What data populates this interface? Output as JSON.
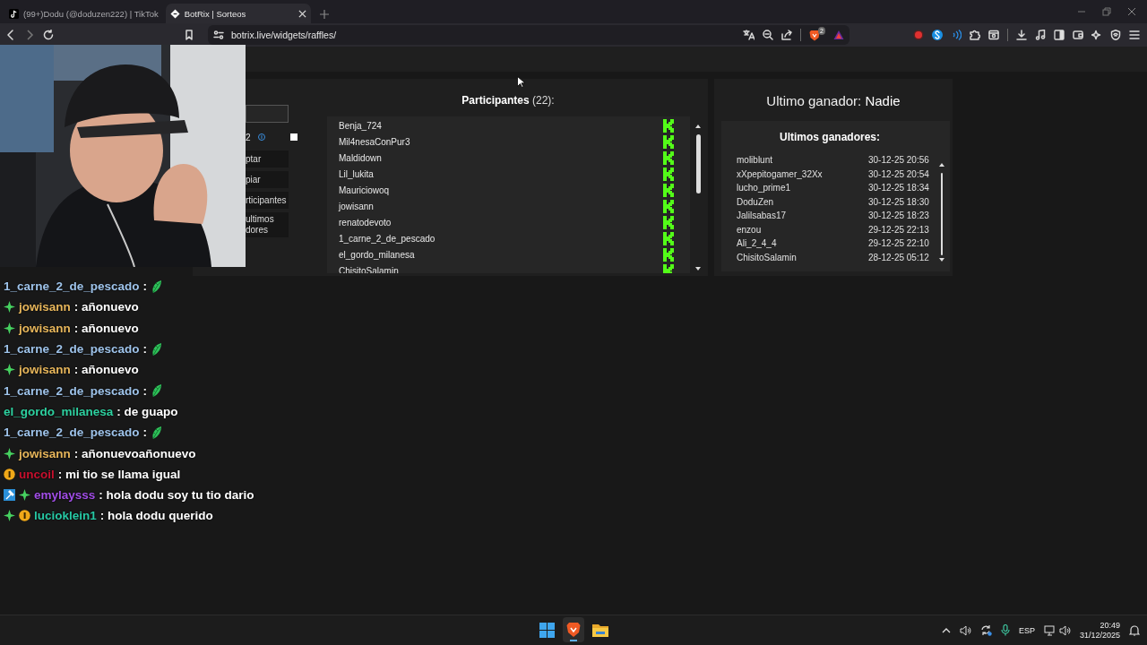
{
  "browser": {
    "tabs": [
      {
        "title": "(99+)Dodu (@doduzen222) | TikTok",
        "selected": false
      },
      {
        "title": "BotRix | Sorteos",
        "selected": true
      }
    ],
    "address": "botrix.live/widgets/raffles/",
    "shield_badge": "2"
  },
  "controls": {
    "number": "2",
    "checked": false,
    "buttons": [
      "ptar",
      "piar",
      "rticipantes",
      "ultimos dores"
    ]
  },
  "participants": {
    "title": "**Participantes** (22):",
    "items": [
      "Benja_724",
      "Mil4nesaConPur3",
      "Maldidown",
      "Lil_lukita",
      "Mauriciowoq",
      "jowisann",
      "renatodevoto",
      "1_carne_2_de_pescado",
      "el_gordo_milanesa",
      "ChisitoSalamin"
    ]
  },
  "last_winner": "Ultimo ganador: **Nadie**",
  "winners": {
    "title": "Ultimos ganadores:",
    "rows": [
      {
        "name": "moliblunt",
        "date": "30-12-25 20:56"
      },
      {
        "name": "xXpepitogamer_32Xx",
        "date": "30-12-25 20:54"
      },
      {
        "name": "lucho_prime1",
        "date": "30-12-25 18:34"
      },
      {
        "name": "DoduZen",
        "date": "30-12-25 18:30"
      },
      {
        "name": "Jalilsabas17",
        "date": "30-12-25 18:23"
      },
      {
        "name": "enzou",
        "date": "29-12-25 22:13"
      },
      {
        "name": "Ali_2_4_4",
        "date": "29-12-25 22:10"
      },
      {
        "name": "ChisitoSalamin",
        "date": "28-12-25 05:12"
      }
    ]
  },
  "chat": [
    {
      "user": "1_carne_2_de_pescado",
      "color": "#9ec3ea",
      "message": ":",
      "emote": true
    },
    {
      "user": "jowisann",
      "color": "#e7b65b",
      "badges": [
        {
          "kind": "sparkle"
        }
      ],
      "message": ": añonuevo",
      "emote": false
    },
    {
      "user": "jowisann",
      "color": "#e7b65b",
      "badges": [
        {
          "kind": "sparkle"
        }
      ],
      "message": ": añonuevo",
      "emote": false
    },
    {
      "user": "1_carne_2_de_pescado",
      "color": "#9ec3ea",
      "message": ":",
      "emote": true
    },
    {
      "user": "jowisann",
      "color": "#e7b65b",
      "badges": [
        {
          "kind": "sparkle"
        }
      ],
      "message": ": añonuevo",
      "emote": false
    },
    {
      "user": "1_carne_2_de_pescado",
      "color": "#9ec3ea",
      "message": ":",
      "emote": true
    },
    {
      "user": "el_gordo_milanesa",
      "color": "#2ed1a0",
      "message": ": de guapo",
      "emote": false
    },
    {
      "user": "1_carne_2_de_pescado",
      "color": "#9ec3ea",
      "message": ":",
      "emote": true
    },
    {
      "user": "jowisann",
      "color": "#e7b65b",
      "badges": [
        {
          "kind": "sparkle"
        }
      ],
      "message": ": añonuevoañonuevo",
      "emote": false
    },
    {
      "user": "uncoil",
      "color": "#c8102e",
      "badges": [
        {
          "kind": "sub"
        }
      ],
      "message": ": mi tio se llama igual",
      "emote": false
    },
    {
      "user": "emylaysss",
      "color": "#a24ee8",
      "badges": [
        {
          "kind": "mod"
        },
        {
          "kind": "sparkle"
        }
      ],
      "message": ": hola dodu soy tu tio dario",
      "emote": false
    },
    {
      "user": "lucioklein1",
      "color": "#27c9a5",
      "badges": [
        {
          "kind": "sparkle"
        },
        {
          "kind": "sub"
        }
      ],
      "message": ": hola dodu querido",
      "emote": false
    }
  ],
  "taskbar": {
    "language": "ESP",
    "time": "20:49",
    "date": "31/12/2025"
  }
}
